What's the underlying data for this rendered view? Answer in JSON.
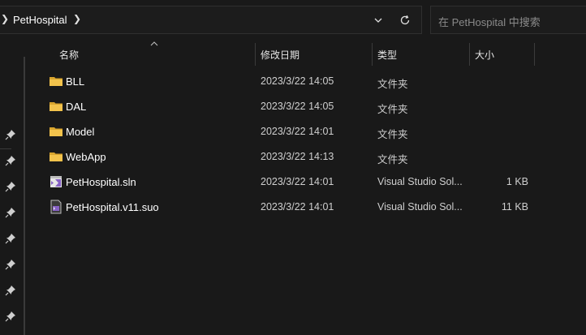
{
  "address": {
    "path_item": "PetHospital"
  },
  "search": {
    "placeholder": "在 PetHospital 中搜索"
  },
  "columns": {
    "name": "名称",
    "modified": "修改日期",
    "type": "类型",
    "size": "大小"
  },
  "files": [
    {
      "name": "BLL",
      "modified": "2023/3/22 14:05",
      "type": "文件夹",
      "size": "",
      "icon": "folder-icon"
    },
    {
      "name": "DAL",
      "modified": "2023/3/22 14:05",
      "type": "文件夹",
      "size": "",
      "icon": "folder-icon"
    },
    {
      "name": "Model",
      "modified": "2023/3/22 14:01",
      "type": "文件夹",
      "size": "",
      "icon": "folder-icon"
    },
    {
      "name": "WebApp",
      "modified": "2023/3/22 14:13",
      "type": "文件夹",
      "size": "",
      "icon": "folder-icon"
    },
    {
      "name": "PetHospital.sln",
      "modified": "2023/3/22 14:01",
      "type": "Visual Studio Sol...",
      "size": "1 KB",
      "icon": "visual-studio-solution-icon"
    },
    {
      "name": "PetHospital.v11.suo",
      "modified": "2023/3/22 14:01",
      "type": "Visual Studio Sol...",
      "size": "11 KB",
      "icon": "visual-studio-suo-icon"
    }
  ],
  "colors": {
    "background": "#191919",
    "folder": "#f3c34c",
    "vs_purple": "#8661c5"
  }
}
